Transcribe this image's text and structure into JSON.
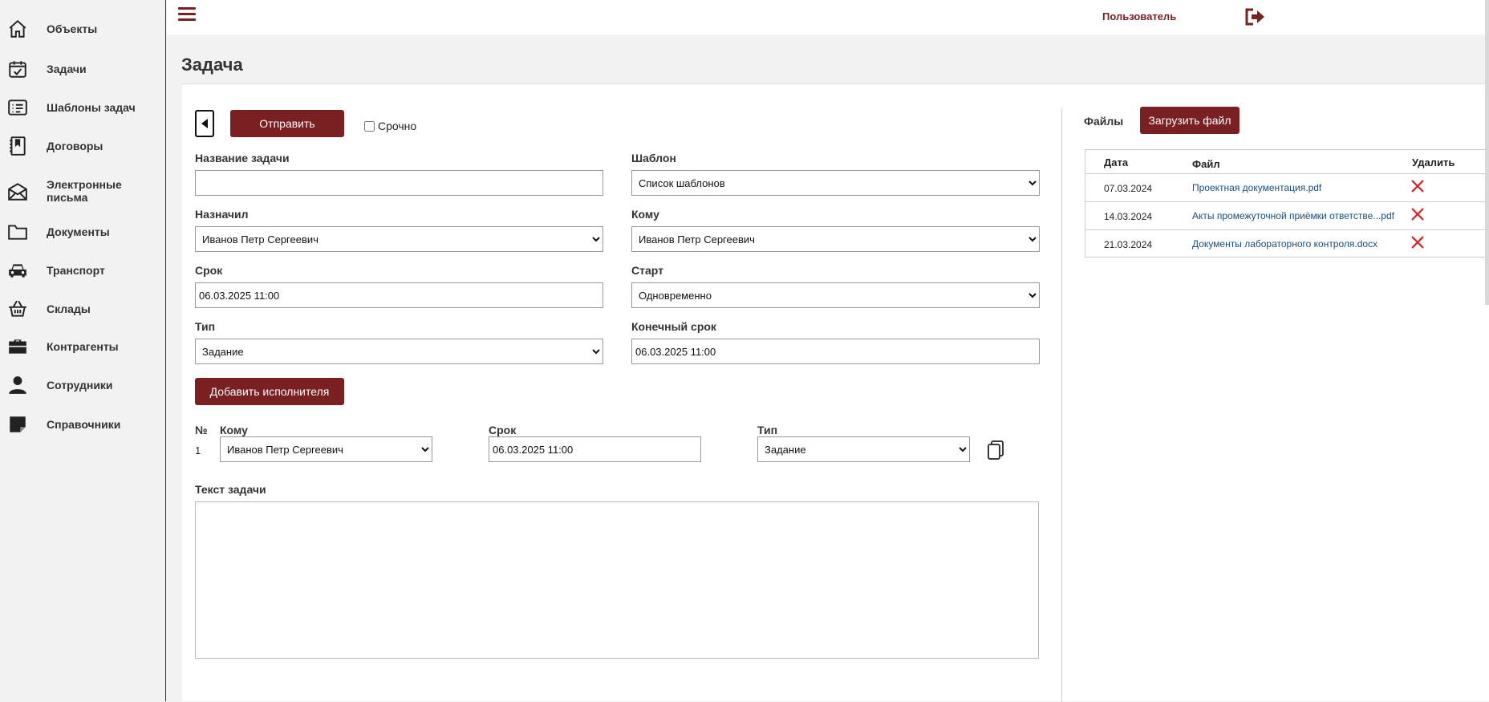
{
  "colors": {
    "accent": "#7a1f22",
    "link": "#1a4d80",
    "delete": "#e11d1d"
  },
  "sidebar": {
    "items": [
      {
        "label": "Объекты",
        "icon": "home-icon"
      },
      {
        "label": "Задачи",
        "icon": "calendar-check-icon"
      },
      {
        "label": "Шаблоны задач",
        "icon": "list-icon"
      },
      {
        "label": "Договоры",
        "icon": "contract-icon"
      },
      {
        "label": "Электронные письма",
        "icon": "envelope-icon"
      },
      {
        "label": "Документы",
        "icon": "folder-icon"
      },
      {
        "label": "Транспорт",
        "icon": "car-icon"
      },
      {
        "label": "Склады",
        "icon": "basket-icon"
      },
      {
        "label": "Контрагенты",
        "icon": "briefcase-icon"
      },
      {
        "label": "Сотрудники",
        "icon": "person-icon"
      },
      {
        "label": "Справочники",
        "icon": "reference-icon"
      }
    ]
  },
  "header": {
    "user_label": "Пользователь",
    "menu_icon": "hamburger-icon",
    "logout_icon": "logout-icon"
  },
  "page": {
    "title": "Задача"
  },
  "form": {
    "send_label": "Отправить",
    "urgent_label": "Срочно",
    "task_name_label": "Название задачи",
    "task_name_value": "",
    "template_label": "Шаблон",
    "template_value": "Список шаблонов",
    "assigned_by_label": "Назначил",
    "assigned_by_value": "Иванов Петр Сергеевич",
    "to_label": "Кому",
    "to_value": "Иванов Петр Сергеевич",
    "deadline_label": "Срок",
    "deadline_value": "06.03.2025 11:00",
    "start_label": "Старт",
    "start_value": "Одновременно",
    "type_label": "Тип",
    "type_value": "Задание",
    "final_deadline_label": "Конечный срок",
    "final_deadline_value": "06.03.2025 11:00",
    "add_executor_label": "Добавить исполнителя",
    "text_label": "Текст задачи",
    "text_value": ""
  },
  "executors": {
    "headers": {
      "num": "№",
      "to": "Кому",
      "deadline": "Срок",
      "type": "Тип"
    },
    "rows": [
      {
        "num": "1",
        "to": "Иванов Петр Сергеевич",
        "deadline": "06.03.2025 11:00",
        "type": "Задание"
      }
    ]
  },
  "files": {
    "title": "Файлы",
    "upload_label": "Загрузить файл",
    "headers": {
      "date": "Дата",
      "file": "Файл",
      "delete": "Удалить"
    },
    "rows": [
      {
        "date": "07.03.2024",
        "file": "Проектная документация.pdf"
      },
      {
        "date": "14.03.2024",
        "file": "Акты промежуточной приёмки ответстве...pdf"
      },
      {
        "date": "21.03.2024",
        "file": "Документы лабораторного контроля.docx"
      }
    ]
  }
}
